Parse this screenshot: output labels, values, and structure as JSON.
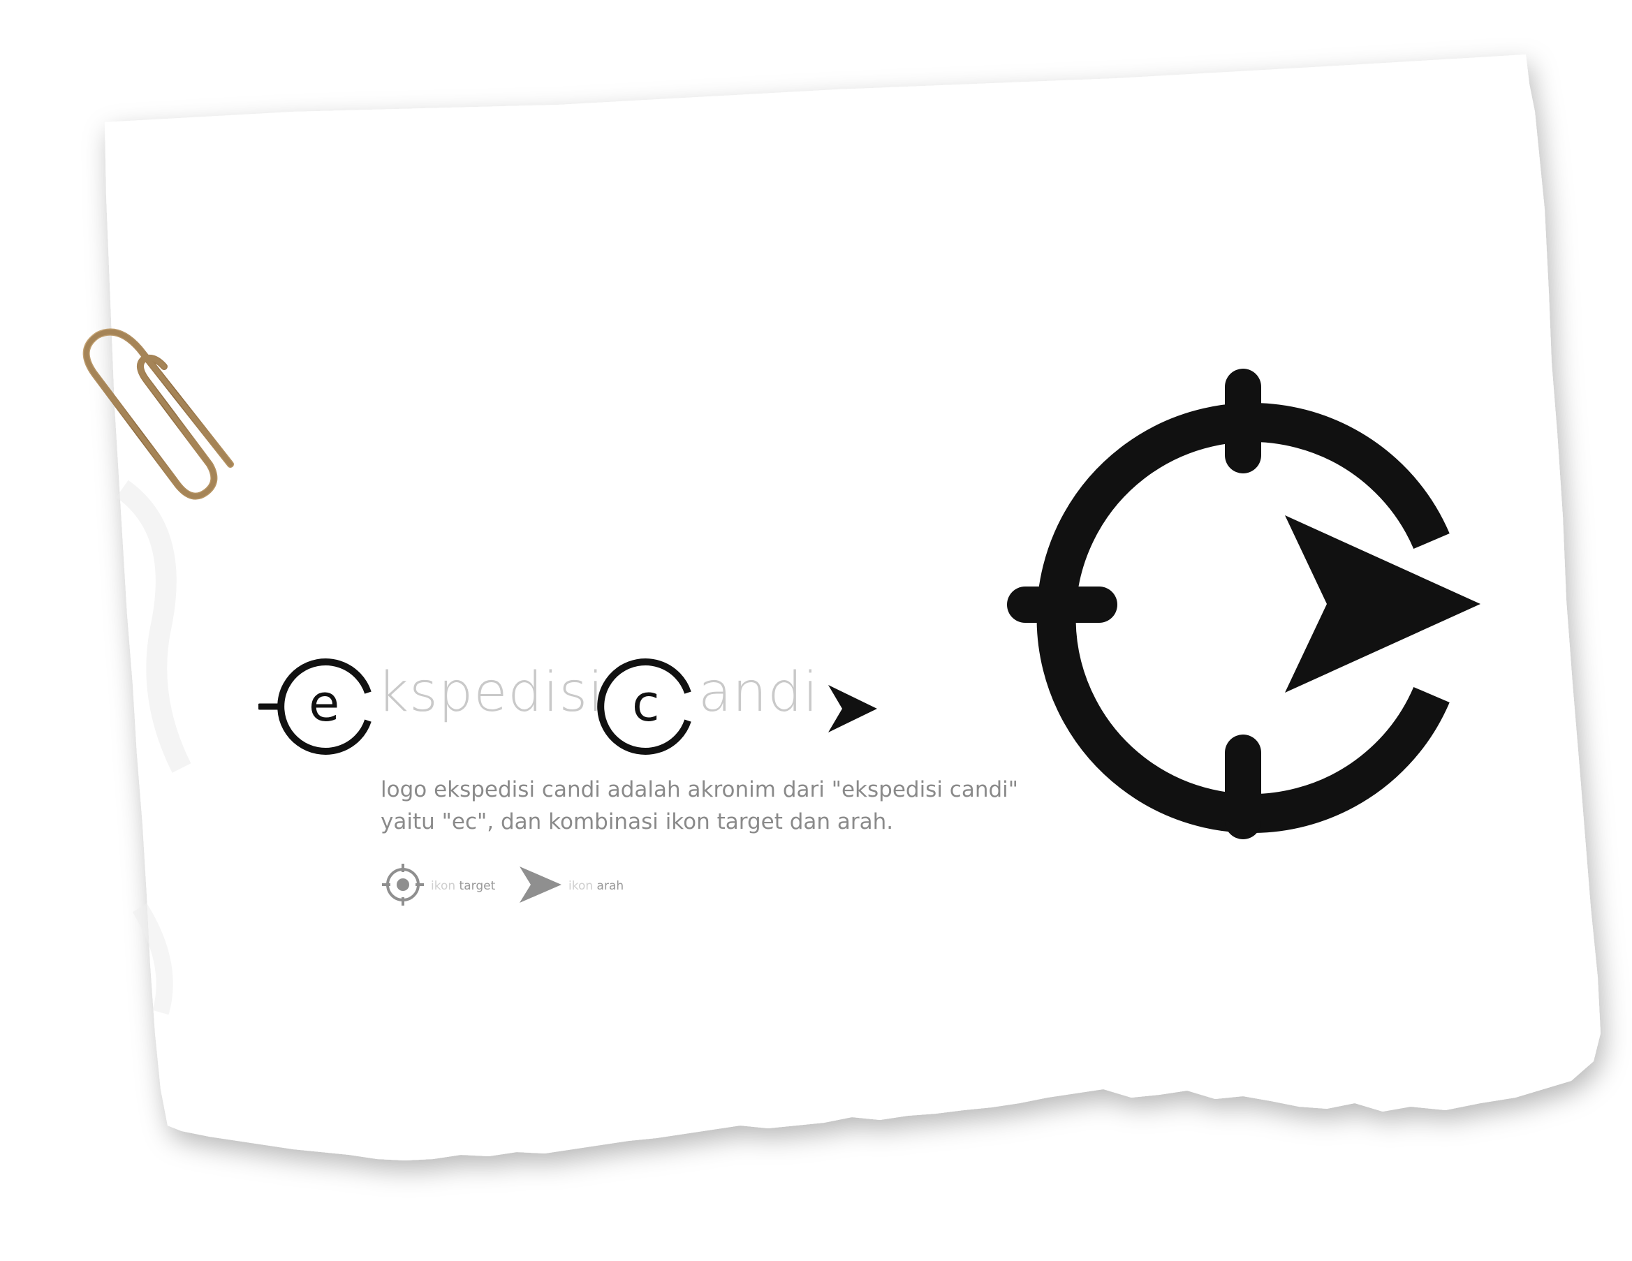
{
  "logo": {
    "letter_e": "e",
    "word_1": "kspedisi",
    "letter_c": "c",
    "word_2": "andi"
  },
  "description": {
    "line_1": "logo ekspedisi candi adalah akronim dari \"ekspedisi candi\"",
    "line_2": "yaitu \"ec\", dan kombinasi ikon target dan arah."
  },
  "legend": {
    "target": {
      "prefix": "ikon",
      "name": "target",
      "icon": "target-icon"
    },
    "arrow": {
      "prefix": "ikon",
      "name": "arah",
      "icon": "arrow-icon"
    }
  },
  "colors": {
    "ink": "#111111",
    "word_grey": "#c9c9c9",
    "text_grey": "#8a8a8a",
    "icon_grey": "#8f8f8f",
    "paper": "#ffffff",
    "clip": "#a58457"
  }
}
